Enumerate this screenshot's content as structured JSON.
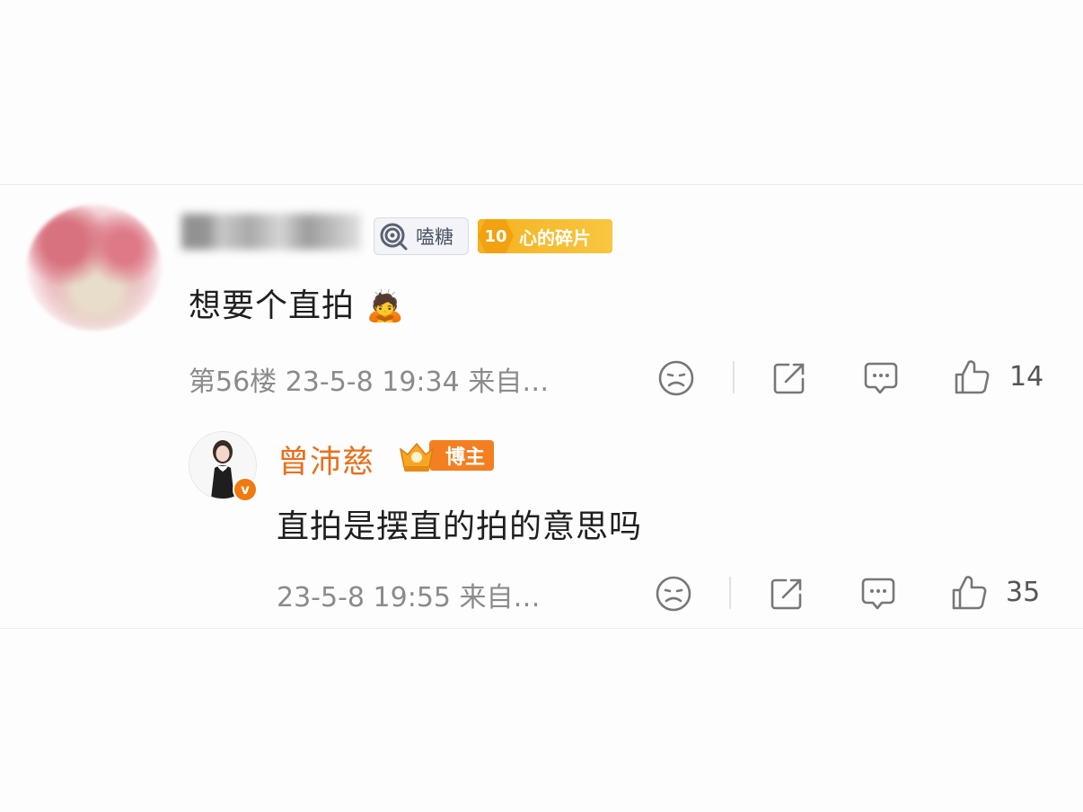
{
  "comment": {
    "badge_label": "嗑糖",
    "fan_level": "10",
    "fan_badge_label": "心的碎片",
    "text": "想要个直拍",
    "emoji": "🙇",
    "meta": "第56楼 23-5-8 19:34 来自…",
    "like_count": "14"
  },
  "reply": {
    "author": "曾沛慈",
    "verified_mark": "v",
    "blogger_label": "博主",
    "text": "直拍是摆直的拍的意思吗",
    "meta": "23-5-8 19:55 来自…",
    "like_count": "35"
  },
  "colors": {
    "author_name": "#e8701a",
    "blogger_badge": "#f47f21",
    "fan_badge": "#f6b11f",
    "icon_gray": "#777777"
  },
  "icons": [
    "dislike-icon",
    "share-icon",
    "comment-icon",
    "like-icon"
  ]
}
